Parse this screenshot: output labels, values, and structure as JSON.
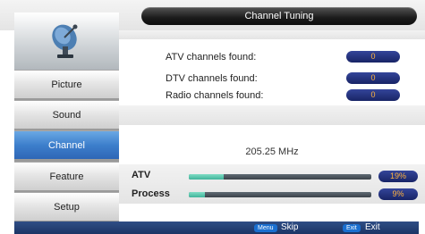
{
  "header": {
    "title": "Channel Tuning"
  },
  "sidebar": {
    "items": [
      {
        "label": "Picture",
        "selected": false
      },
      {
        "label": "Sound",
        "selected": false
      },
      {
        "label": "Channel",
        "selected": true
      },
      {
        "label": "Feature",
        "selected": false
      },
      {
        "label": "Setup",
        "selected": false
      }
    ]
  },
  "results": [
    {
      "label": "ATV channels found:",
      "value": "0"
    },
    {
      "label": "DTV channels found:",
      "value": "0"
    },
    {
      "label": "Radio channels found:",
      "value": "0"
    }
  ],
  "frequency": "205.25 MHz",
  "progress": [
    {
      "label": "ATV",
      "percent": 19,
      "value_text": "19%"
    },
    {
      "label": "Process",
      "percent": 9,
      "value_text": "9%"
    }
  ],
  "footer": {
    "menu_key": "Menu",
    "menu_action": "Skip",
    "exit_key": "Exit",
    "exit_action": "Exit"
  },
  "colors": {
    "selected_menu": "#3d7fcc",
    "pill_bg": "#182466",
    "pill_text": "#ffb23e",
    "progress_fill": "#3fb49a"
  }
}
